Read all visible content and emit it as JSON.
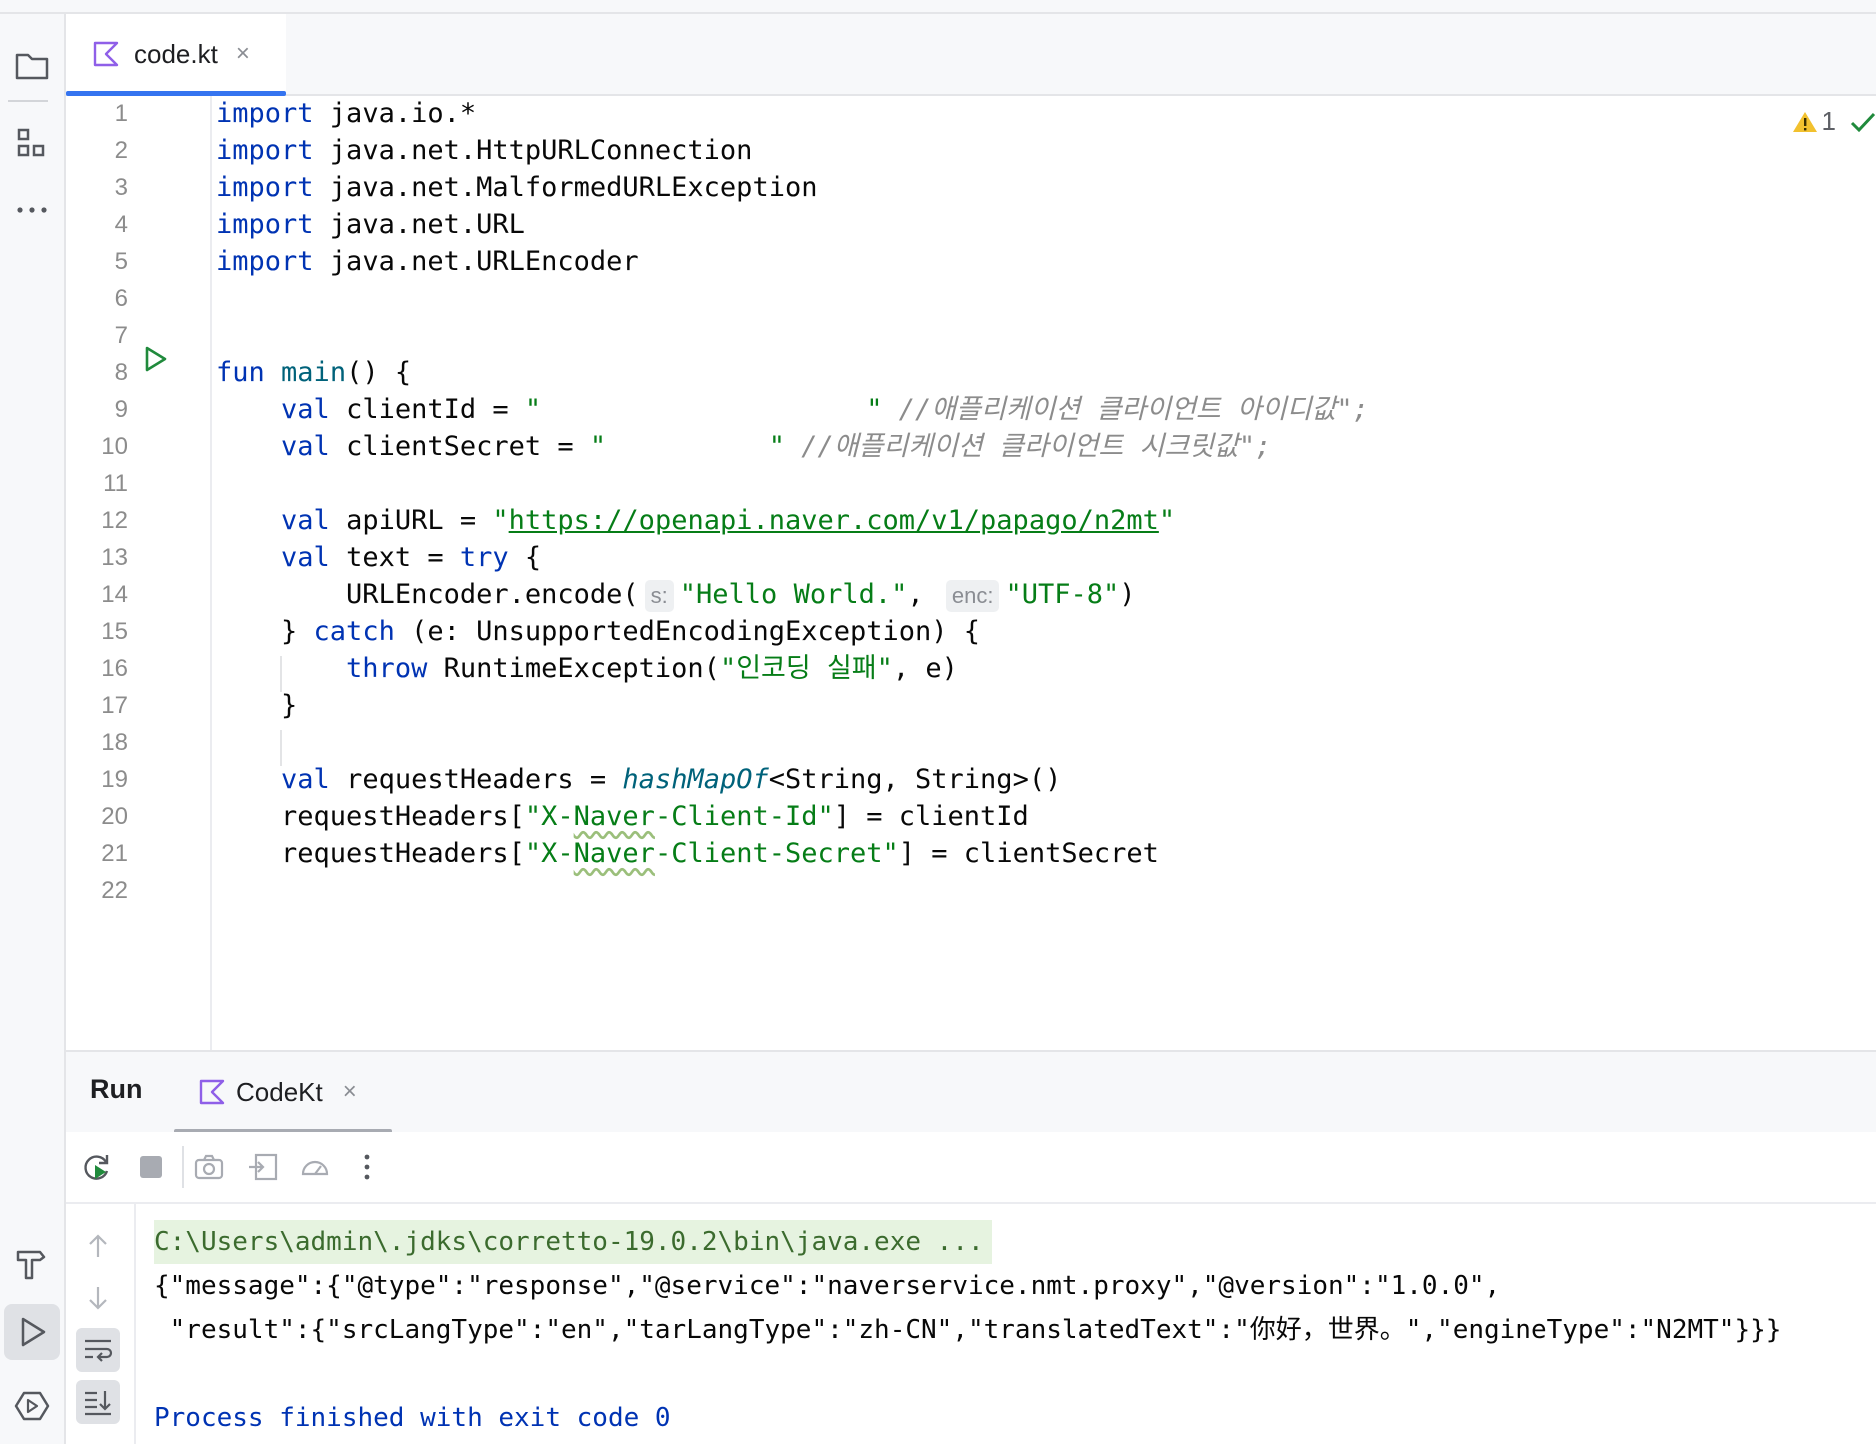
{
  "editor_tab": {
    "label": "code.kt",
    "close": "×"
  },
  "inspections": {
    "warning_count": "1"
  },
  "line_numbers": [
    "1",
    "2",
    "3",
    "4",
    "5",
    "6",
    "7",
    "8",
    "9",
    "10",
    "11",
    "12",
    "13",
    "14",
    "15",
    "16",
    "17",
    "18",
    "19",
    "20",
    "21",
    "22"
  ],
  "code": {
    "l1": {
      "kw": "import",
      "rest": " java.io.*"
    },
    "l2": {
      "kw": "import",
      "rest": " java.net.HttpURLConnection"
    },
    "l3": {
      "kw": "import",
      "rest": " java.net.MalformedURLException"
    },
    "l4": {
      "kw": "import",
      "rest": " java.net.URL"
    },
    "l5": {
      "kw": "import",
      "rest": " java.net.URLEncoder"
    },
    "l8": {
      "kw": "fun",
      "fn": "main",
      "rest": "() {"
    },
    "l9": {
      "kw": "val",
      "mid": " clientId = ",
      "str": "\"                    \"",
      "cmt": " //애플리케이션 클라이언트 아이디값\";"
    },
    "l10": {
      "kw": "val",
      "mid": " clientSecret = ",
      "str": "\"          \"",
      "cmt": " //애플리케이션 클라이언트 시크릿값\";"
    },
    "l12": {
      "kw": "val",
      "mid": " apiURL = ",
      "q1": "\"",
      "url": "https://openapi.naver.com/v1/papago/n2mt",
      "q2": "\""
    },
    "l13": {
      "kw": "val",
      "mid": " text = ",
      "kw2": "try",
      "rest": " {"
    },
    "l14": {
      "pre": "URLEncoder.encode(",
      "hint1": "s:",
      "str1": "\"Hello World.\"",
      "comma": ",",
      "hint2": "enc:",
      "str2": "\"UTF-8\"",
      "post": ")"
    },
    "l15": {
      "pre": "} ",
      "kw": "catch",
      "rest": " (e: UnsupportedEncodingException) {"
    },
    "l16": {
      "kw": "throw",
      "mid": " RuntimeException(",
      "str": "\"인코딩 실패\"",
      "rest": ", e)"
    },
    "l17": {
      "rest": "}"
    },
    "l19": {
      "kw": "val",
      "mid": " requestHeaders = ",
      "ital": "hashMapOf",
      "rest": "<String, String>()"
    },
    "l20": {
      "pre": "requestHeaders[",
      "q1": "\"X-",
      "wavy": "Naver",
      "q2": "-Client-Id\"",
      "rest": "] = clientId"
    },
    "l21": {
      "pre": "requestHeaders[",
      "q1": "\"X-",
      "wavy": "Naver",
      "q2": "-Client-Secret\"",
      "rest": "] = clientSecret"
    }
  },
  "run_panel": {
    "title": "Run",
    "tab_label": "CodeKt",
    "tab_close": "×"
  },
  "console": {
    "command": "C:\\Users\\admin\\.jdks\\corretto-19.0.2\\bin\\java.exe ...",
    "out1": "{\"message\":{\"@type\":\"response\",\"@service\":\"naverservice.nmt.proxy\",\"@version\":\"1.0.0\",",
    "out2": " \"result\":{\"srcLangType\":\"en\",\"tarLangType\":\"zh-CN\",\"translatedText\":\"你好，世界。\",\"engineType\":\"N2MT\"}}}",
    "exit": "Process finished with exit code 0"
  },
  "colors": {
    "keyword": "#0033b3",
    "string": "#067d17",
    "comment": "#8c8c8c",
    "accent": "#3574f0",
    "run_green": "#208a3c",
    "warning": "#e3a500"
  },
  "icons": [
    "folder-icon",
    "structure-icon",
    "more-icon",
    "build-icon",
    "run-icon",
    "services-icon",
    "kotlin-file-icon",
    "warning-icon",
    "checkmark-icon",
    "rerun-icon",
    "stop-icon",
    "screenshot-icon",
    "restore-layout-icon",
    "profiler-icon",
    "kebab-icon",
    "arrow-up-icon",
    "arrow-down-icon",
    "soft-wrap-icon",
    "scroll-to-end-icon"
  ]
}
